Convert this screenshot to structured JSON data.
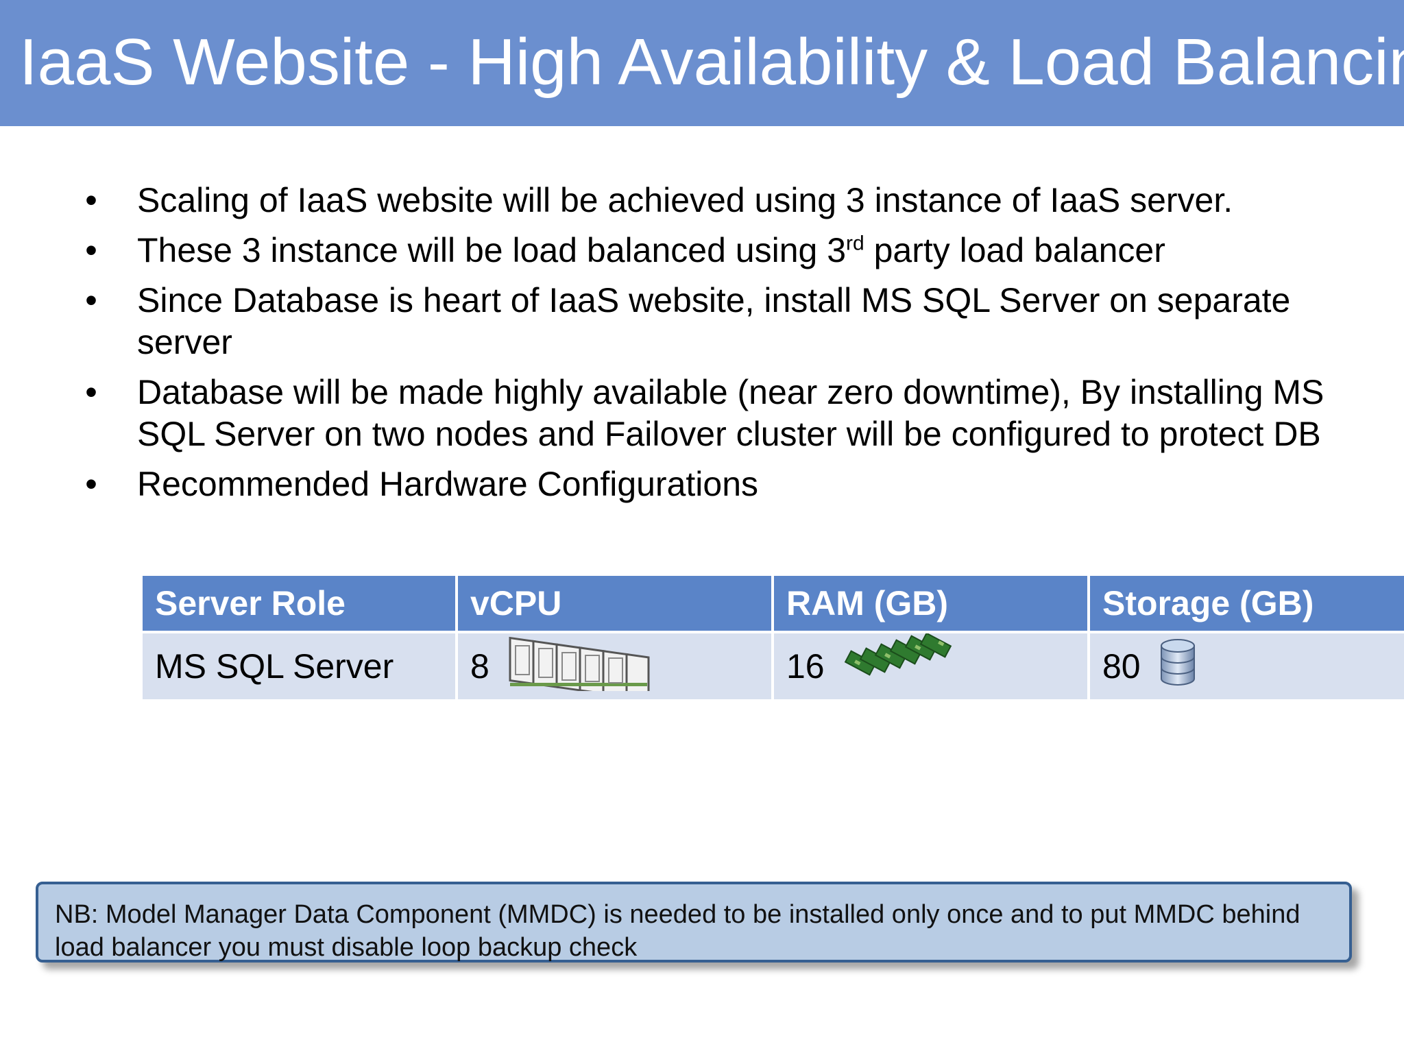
{
  "slide": {
    "title": "IaaS Website - High Availability & Load Balancing",
    "title_bar_color": "#6b8fcf"
  },
  "bullets": [
    {
      "text": "Scaling of IaaS website will be achieved using 3 instance of IaaS server."
    },
    {
      "text_before": "These 3 instance will be load balanced using 3",
      "superscript": "rd",
      "text_after": " party load balancer"
    },
    {
      "text": "Since Database is heart of IaaS website, install MS SQL Server on separate server"
    },
    {
      "text": "Database will be made highly available (near zero downtime), By installing MS SQL Server on two nodes and Failover cluster will be configured to protect DB"
    },
    {
      "text": "Recommended Hardware Configurations"
    }
  ],
  "bullet_symbol": "•",
  "hardware_table": {
    "columns": [
      "Server Role",
      "vCPU",
      "RAM (GB)",
      "Storage (GB)"
    ],
    "rows": [
      {
        "server_role": "MS SQL Server",
        "vcpu": "8",
        "ram": "16",
        "storage": "80"
      }
    ],
    "icons": {
      "vcpu": "cpu-chips-icon",
      "ram": "ram-modules-icon",
      "storage": "database-disk-icon"
    },
    "header_color": "#5a84c8",
    "row_color": "#d8e0ef"
  },
  "note": {
    "text": "NB: Model Manager Data Component (MMDC) is needed to be installed only once and to put MMDC behind load balancer you must disable loop backup check",
    "background": "#b8cce4",
    "border": "#365f91"
  }
}
